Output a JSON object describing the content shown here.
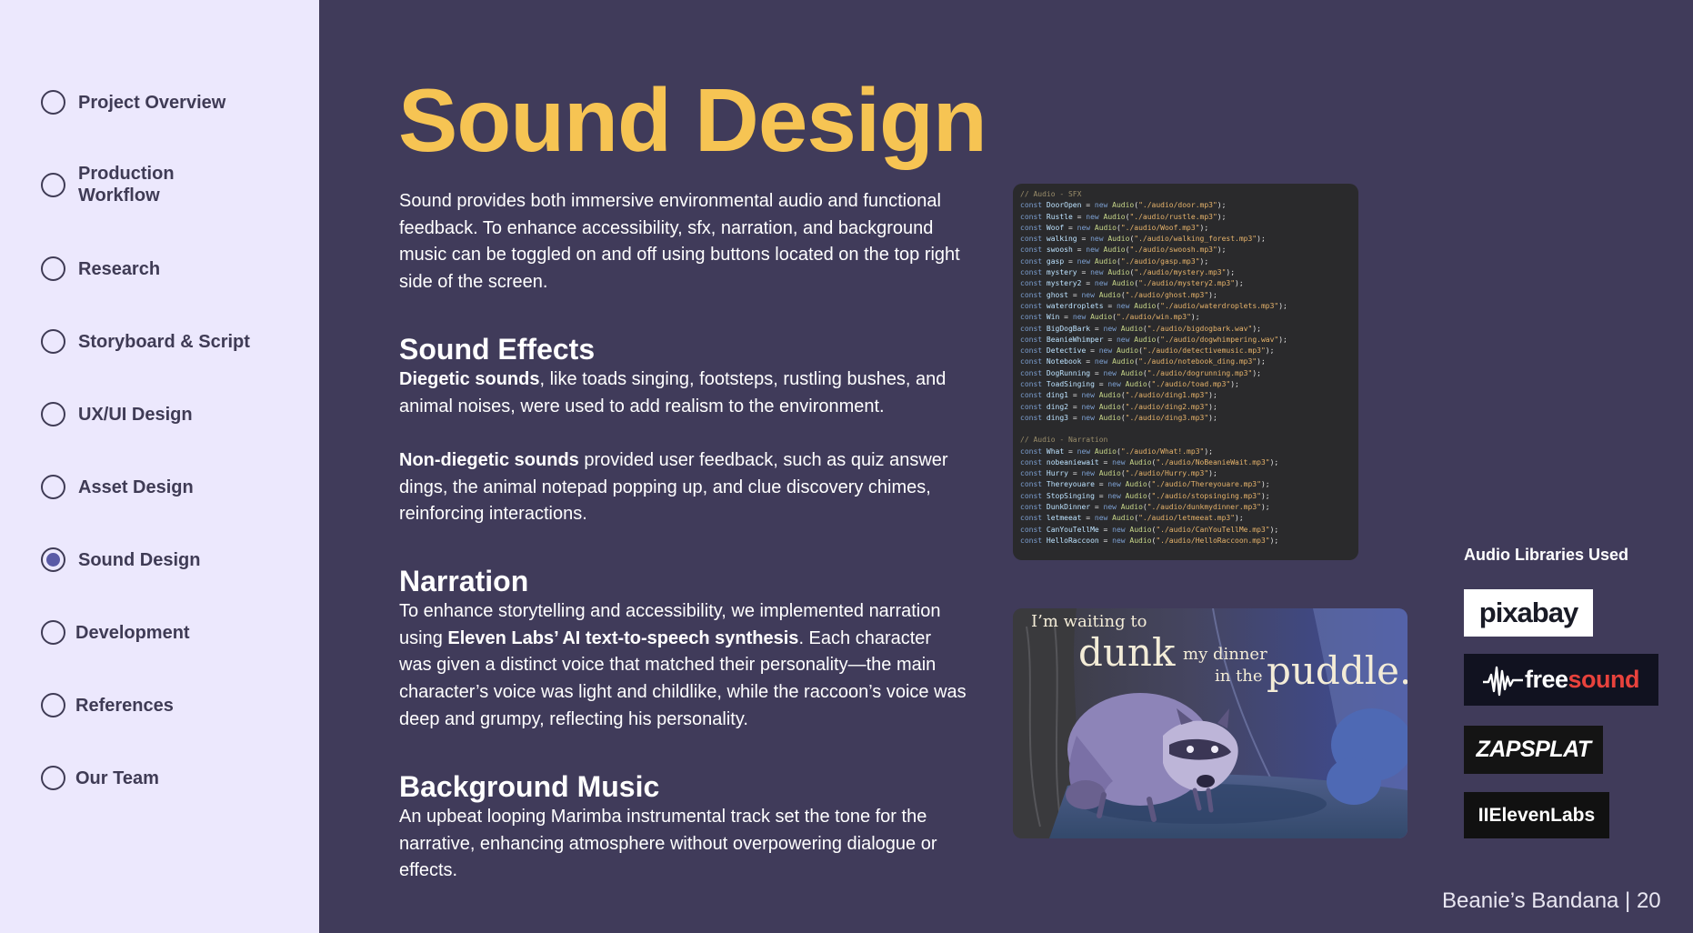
{
  "sidebar": {
    "items": [
      {
        "label": "Project Overview",
        "selected": false
      },
      {
        "label": "Production Workflow",
        "selected": false
      },
      {
        "label": "Research",
        "selected": false
      },
      {
        "label": "Storyboard & Script",
        "selected": false
      },
      {
        "label": "UX/UI Design",
        "selected": false
      },
      {
        "label": "Asset Design",
        "selected": false
      },
      {
        "label": "Sound Design",
        "selected": true
      },
      {
        "label": "Development",
        "selected": false
      },
      {
        "label": "References",
        "selected": false
      },
      {
        "label": "Our Team",
        "selected": false
      }
    ]
  },
  "main": {
    "title": "Sound Design",
    "intro": "Sound provides both immersive environmental audio and functional feedback. To enhance accessibility, sfx, narration, and background music can be toggled on and off using buttons located on the top right side of the screen.",
    "sound_effects": {
      "heading": "Sound Effects",
      "diegetic_bold": "Diegetic sounds",
      "diegetic_rest": ", like toads singing, footsteps, rustling bushes, and animal noises, were used to add realism to the environment.",
      "nondiegetic_bold": "Non-diegetic sounds",
      "nondiegetic_rest": " provided user feedback, such as quiz answer dings, the animal notepad popping up, and clue discovery chimes, reinforcing interactions."
    },
    "narration": {
      "heading": "Narration",
      "text_pre": "To enhance storytelling and accessibility, we implemented narration using ",
      "text_bold": "Eleven Labs’ AI text-to-speech synthesis",
      "text_post": ". Each character was given a distinct voice that matched their personality—the main character’s voice was light and childlike, while the raccoon’s voice was deep and grumpy, reflecting his personality."
    },
    "background_music": {
      "heading": "Background Music",
      "text": "An upbeat looping Marimba instrumental track set the tone for the narrative,  enhancing atmosphere without overpowering dialogue or effects."
    }
  },
  "code": {
    "sfx_comment": "// Audio - SFX",
    "sfx": [
      [
        "DoorOpen",
        "./audio/door.mp3"
      ],
      [
        "Rustle",
        "./audio/rustle.mp3"
      ],
      [
        "Woof",
        "./audio/Woof.mp3"
      ],
      [
        "walking",
        "./audio/walking_forest.mp3"
      ],
      [
        "swoosh",
        "./audio/swoosh.mp3"
      ],
      [
        "gasp",
        "./audio/gasp.mp3"
      ],
      [
        "mystery",
        "./audio/mystery.mp3"
      ],
      [
        "mystery2",
        "./audio/mystery2.mp3"
      ],
      [
        "ghost",
        "./audio/ghost.mp3"
      ],
      [
        "waterdroplets",
        "./audio/waterdroplets.mp3"
      ],
      [
        "Win",
        "./audio/win.mp3"
      ],
      [
        "BigDogBark",
        "./audio/bigdogbark.wav"
      ],
      [
        "BeanieWhimper",
        "./audio/dogwhimpering.wav"
      ],
      [
        "Detective",
        "./audio/detectivemusic.mp3"
      ],
      [
        "Notebook",
        "./audio/notebook_ding.mp3"
      ],
      [
        "DogRunning",
        "./audio/dogrunning.mp3"
      ],
      [
        "ToadSinging",
        "./audio/toad.mp3"
      ],
      [
        "ding1",
        "./audio/ding1.mp3"
      ],
      [
        "ding2",
        "./audio/ding2.mp3"
      ],
      [
        "ding3",
        "./audio/ding3.mp3"
      ]
    ],
    "narration_comment": "// Audio - Narration",
    "narration": [
      [
        "What",
        "./audio/What!.mp3"
      ],
      [
        "nobeaniewait",
        "./audio/NoBeanieWait.mp3"
      ],
      [
        "Hurry",
        "./audio/Hurry.mp3"
      ],
      [
        "Thereyouare",
        "./audio/Thereyouare.mp3"
      ],
      [
        "StopSinging",
        "./audio/stopsinging.mp3"
      ],
      [
        "DunkDinner",
        "./audio/dunkmydinner.mp3"
      ],
      [
        "letmeeat",
        "./audio/letmeeat.mp3"
      ],
      [
        "CanYouTellMe",
        "./audio/CanYouTellMe.mp3"
      ],
      [
        "HelloRaccoon",
        "./audio/HelloRaccoon.mp3"
      ]
    ]
  },
  "illustration": {
    "line1": "I’m waiting to",
    "word_dunk": "dunk",
    "word_mydinner": "my dinner",
    "word_inthe": "in the",
    "word_puddle": "puddle."
  },
  "libraries": {
    "title": "Audio Libraries Used",
    "pixabay": "pixabay",
    "freesound_free": "free",
    "freesound_sound": "sound",
    "zapsplat": "ZAPSPLAT",
    "elevenlabs": "IIElevenLabs"
  },
  "footer": {
    "text": "Beanie’s Bandana | 20"
  },
  "colors": {
    "background": "#403b5a",
    "sidebar": "#ece8fd",
    "title": "#f6c453",
    "selected_dot": "#5a5aa6",
    "freesound_red": "#e8423c"
  }
}
